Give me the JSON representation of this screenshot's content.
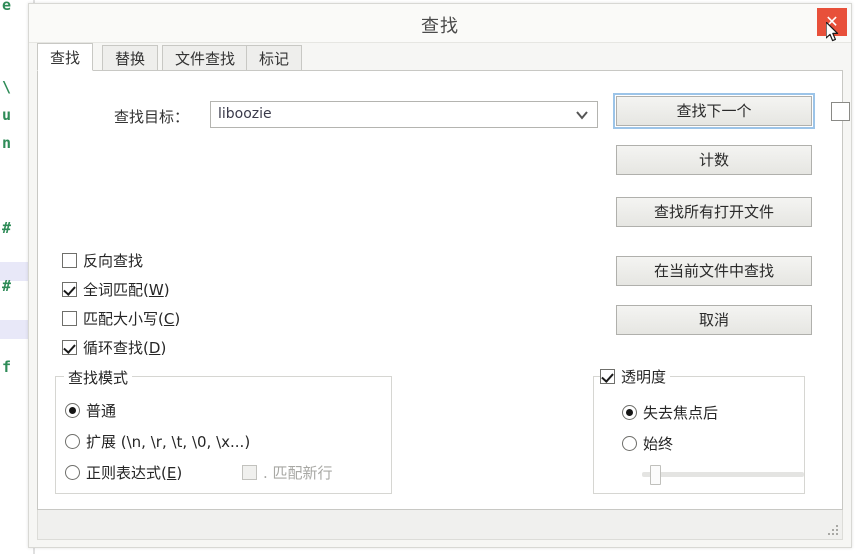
{
  "window": {
    "title": "查找",
    "close_label": "✕",
    "close_color": "#e8503a"
  },
  "tabs": [
    {
      "label": "查找",
      "active": true
    },
    {
      "label": "替换",
      "active": false
    },
    {
      "label": "文件查找",
      "active": false
    },
    {
      "label": "标记",
      "active": false
    }
  ],
  "find": {
    "label": "查找目标：",
    "value": "liboozie",
    "placeholder": "",
    "dropdown_icon": "chevron-down-icon"
  },
  "buttons": [
    {
      "label": "查找下一个",
      "default": true
    },
    {
      "label": "计数",
      "default": false
    },
    {
      "label": "查找所有打开文件",
      "default": false
    },
    {
      "label": "在当前文件中查找",
      "default": false
    },
    {
      "label": "取消",
      "default": false
    }
  ],
  "find_next_checkbox": {
    "checked": false
  },
  "options": [
    {
      "label": "反向查找",
      "mnemonic": "",
      "checked": false
    },
    {
      "label": "全词匹配",
      "mnemonic": "W",
      "checked": true
    },
    {
      "label": "匹配大小写",
      "mnemonic": "C",
      "checked": false
    },
    {
      "label": "循环查找",
      "mnemonic": "D",
      "checked": true
    }
  ],
  "search_mode": {
    "title": "查找模式",
    "radios": [
      {
        "label": "普通",
        "mnemonic": "",
        "selected": true
      },
      {
        "label": "扩展 (\\n, \\r, \\t, \\0, \\x...)",
        "mnemonic": "",
        "selected": false
      },
      {
        "label": "正则表达式",
        "mnemonic": "E",
        "selected": false
      }
    ],
    "dot_matches_newline": {
      "label": ". 匹配新行",
      "checked": false,
      "disabled": true
    }
  },
  "transparency": {
    "title": "透明度",
    "checked": true,
    "radios": [
      {
        "label": "失去焦点后",
        "selected": true
      },
      {
        "label": "始终",
        "selected": false
      }
    ],
    "slider": {
      "value": 8,
      "min": 0,
      "max": 100
    }
  },
  "editor_background": {
    "lines": [
      "e",
      "\\",
      "u",
      "n",
      "#",
      "#",
      "f"
    ]
  }
}
